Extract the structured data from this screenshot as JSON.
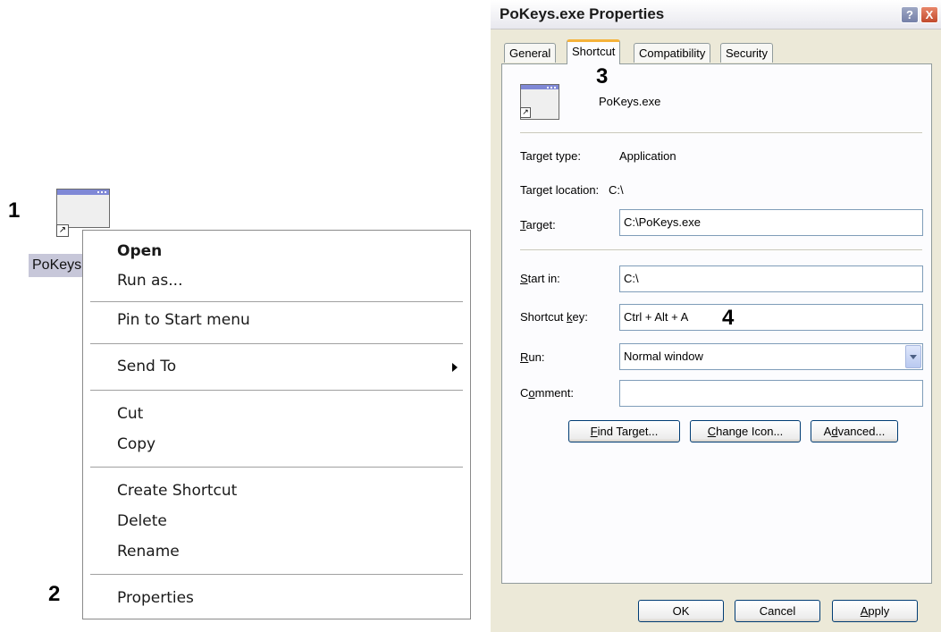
{
  "annotations": {
    "step1": "1",
    "step2": "2",
    "step3": "3",
    "step4": "4"
  },
  "desktop_icon": {
    "label": "PoKeys",
    "icon": "application-shortcut-icon"
  },
  "context_menu": {
    "open": "Open",
    "run_as": "Run as...",
    "pin_start": "Pin to Start menu",
    "send_to": "Send To",
    "cut": "Cut",
    "copy": "Copy",
    "create_shortcut": "Create Shortcut",
    "delete": "Delete",
    "rename": "Rename",
    "properties": "Properties"
  },
  "dialog": {
    "title": "PoKeys.exe Properties",
    "help_btn": "?",
    "close_btn": "X",
    "tabs": [
      "General",
      "Shortcut",
      "Compatibility",
      "Security"
    ],
    "active_tab": "Shortcut",
    "file_name": "PoKeys.exe",
    "target_type_label": "Target type:",
    "target_type_value": "Application",
    "target_location_label": "Target location:",
    "target_location_value": "C:\\",
    "target_label_prefix": "",
    "target_label_u": "T",
    "target_label_rest": "arget:",
    "target_value": "C:\\PoKeys.exe",
    "start_in_label_u": "S",
    "start_in_label_rest": "tart in:",
    "start_in_value": "C:\\",
    "shortcut_key_label_pre": "Shortcut ",
    "shortcut_key_label_u": "k",
    "shortcut_key_label_rest": "ey:",
    "shortcut_key_value": "Ctrl + Alt + A",
    "run_label_u": "R",
    "run_label_rest": "un:",
    "run_value": "Normal window",
    "comment_label_pre": "C",
    "comment_label_u": "o",
    "comment_label_rest": "mment:",
    "comment_value": "",
    "find_target": {
      "u": "F",
      "rest": "ind Target..."
    },
    "change_icon": {
      "u": "C",
      "rest": "hange Icon..."
    },
    "advanced": {
      "pre": "A",
      "u": "d",
      "rest": "vanced..."
    },
    "ok": "OK",
    "cancel": "Cancel",
    "apply": {
      "u": "A",
      "rest": "pply"
    }
  },
  "colors": {
    "tab_highlight": "#f5b23b",
    "field_border": "#7f9db9",
    "dialog_bg": "#ece9d8"
  }
}
